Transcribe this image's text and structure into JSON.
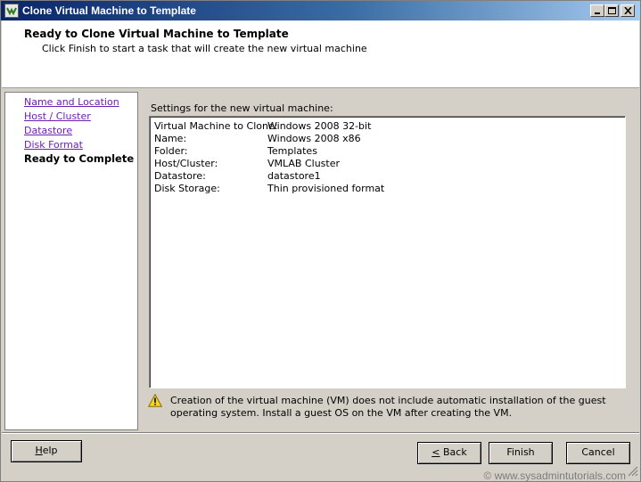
{
  "window": {
    "title": "Clone Virtual Machine to Template"
  },
  "header": {
    "title": "Ready to Clone Virtual Machine to Template",
    "subtitle": "Click Finish to start a task that will create the new virtual machine"
  },
  "nav": {
    "items": [
      {
        "label": "Name and Location",
        "state": "visited"
      },
      {
        "label": "Host / Cluster",
        "state": "visited"
      },
      {
        "label": "Datastore",
        "state": "visited"
      },
      {
        "label": "Disk Format",
        "state": "visited"
      },
      {
        "label": "Ready to Complete",
        "state": "current"
      }
    ]
  },
  "settings": {
    "label": "Settings for the new virtual machine:",
    "rows": [
      {
        "key": "Virtual Machine to Clone:",
        "value": "Windows 2008 32-bit"
      },
      {
        "key": "Name:",
        "value": "Windows 2008 x86"
      },
      {
        "key": "Folder:",
        "value": "Templates"
      },
      {
        "key": "Host/Cluster:",
        "value": "VMLAB Cluster"
      },
      {
        "key": "Datastore:",
        "value": "datastore1"
      },
      {
        "key": "Disk Storage:",
        "value": "Thin provisioned format"
      }
    ]
  },
  "warning": {
    "icon": "warning-icon",
    "text": "Creation of the virtual machine (VM) does not include automatic installation of the guest operating system. Install a guest OS on the VM after creating the VM."
  },
  "footer": {
    "help": {
      "pre": "",
      "mnemonic": "H",
      "post": "elp"
    },
    "back": {
      "pre": "",
      "mnemonic": "<",
      "post": " Back"
    },
    "finish": "Finish",
    "cancel": "Cancel",
    "watermark": "© www.sysadmintutorials.com"
  },
  "colors": {
    "title_bar_start": "#0a246a",
    "title_bar_end": "#a6caf0",
    "link": "#6a1fb5",
    "dialog_face": "#d4d0c8"
  }
}
